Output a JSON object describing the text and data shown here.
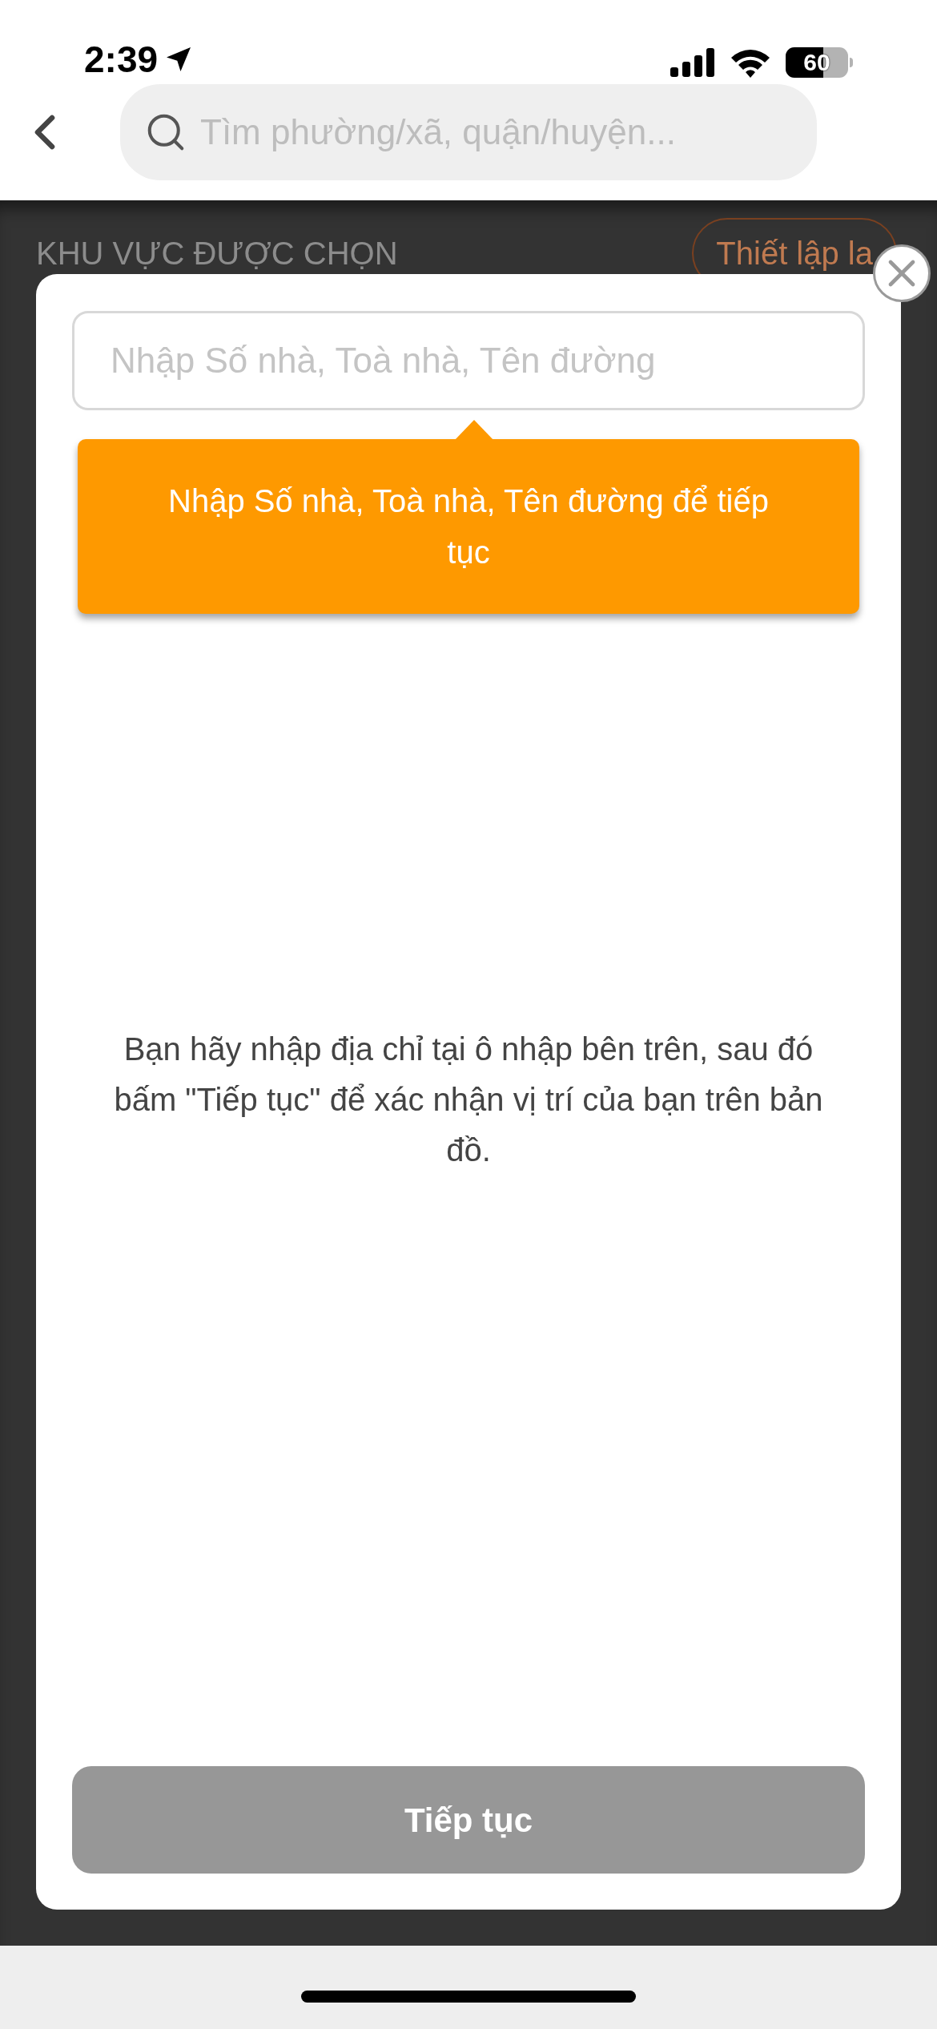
{
  "status_bar": {
    "time": "2:39",
    "battery": "60"
  },
  "header": {
    "search": {
      "placeholder": "Tìm phường/xã, quận/huyện..."
    }
  },
  "background": {
    "section_title": "KHU VỰC ĐƯỢC CHỌN",
    "reset_button": "Thiết lập la"
  },
  "modal": {
    "address_field": {
      "placeholder": "Nhập Số nhà, Toà nhà, Tên đường"
    },
    "tooltip": "Nhập Số nhà, Toà nhà, Tên đường để tiếp tục",
    "message": "Bạn hãy nhập địa chỉ tại ô nhập bên trên, sau đó bấm \"Tiếp tục\" để xác nhận vị trí của bạn trên bản đồ.",
    "continue_button": {
      "label": "Tiếp tục",
      "disabled": true
    }
  }
}
